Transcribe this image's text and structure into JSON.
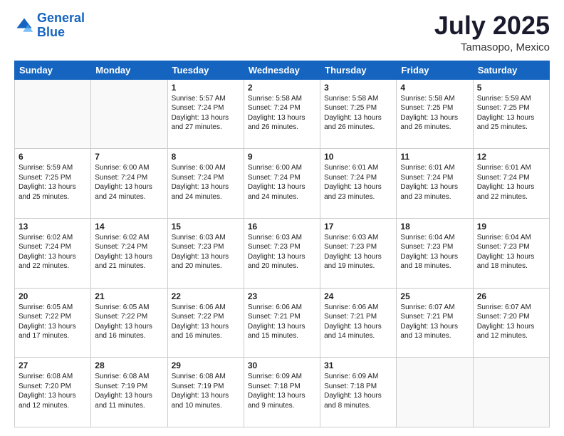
{
  "header": {
    "logo_line1": "General",
    "logo_line2": "Blue",
    "month": "July 2025",
    "location": "Tamasopo, Mexico"
  },
  "days_of_week": [
    "Sunday",
    "Monday",
    "Tuesday",
    "Wednesday",
    "Thursday",
    "Friday",
    "Saturday"
  ],
  "weeks": [
    [
      {
        "day": "",
        "info": ""
      },
      {
        "day": "",
        "info": ""
      },
      {
        "day": "1",
        "info": "Sunrise: 5:57 AM\nSunset: 7:24 PM\nDaylight: 13 hours and 27 minutes."
      },
      {
        "day": "2",
        "info": "Sunrise: 5:58 AM\nSunset: 7:24 PM\nDaylight: 13 hours and 26 minutes."
      },
      {
        "day": "3",
        "info": "Sunrise: 5:58 AM\nSunset: 7:25 PM\nDaylight: 13 hours and 26 minutes."
      },
      {
        "day": "4",
        "info": "Sunrise: 5:58 AM\nSunset: 7:25 PM\nDaylight: 13 hours and 26 minutes."
      },
      {
        "day": "5",
        "info": "Sunrise: 5:59 AM\nSunset: 7:25 PM\nDaylight: 13 hours and 25 minutes."
      }
    ],
    [
      {
        "day": "6",
        "info": "Sunrise: 5:59 AM\nSunset: 7:25 PM\nDaylight: 13 hours and 25 minutes."
      },
      {
        "day": "7",
        "info": "Sunrise: 6:00 AM\nSunset: 7:24 PM\nDaylight: 13 hours and 24 minutes."
      },
      {
        "day": "8",
        "info": "Sunrise: 6:00 AM\nSunset: 7:24 PM\nDaylight: 13 hours and 24 minutes."
      },
      {
        "day": "9",
        "info": "Sunrise: 6:00 AM\nSunset: 7:24 PM\nDaylight: 13 hours and 24 minutes."
      },
      {
        "day": "10",
        "info": "Sunrise: 6:01 AM\nSunset: 7:24 PM\nDaylight: 13 hours and 23 minutes."
      },
      {
        "day": "11",
        "info": "Sunrise: 6:01 AM\nSunset: 7:24 PM\nDaylight: 13 hours and 23 minutes."
      },
      {
        "day": "12",
        "info": "Sunrise: 6:01 AM\nSunset: 7:24 PM\nDaylight: 13 hours and 22 minutes."
      }
    ],
    [
      {
        "day": "13",
        "info": "Sunrise: 6:02 AM\nSunset: 7:24 PM\nDaylight: 13 hours and 22 minutes."
      },
      {
        "day": "14",
        "info": "Sunrise: 6:02 AM\nSunset: 7:24 PM\nDaylight: 13 hours and 21 minutes."
      },
      {
        "day": "15",
        "info": "Sunrise: 6:03 AM\nSunset: 7:23 PM\nDaylight: 13 hours and 20 minutes."
      },
      {
        "day": "16",
        "info": "Sunrise: 6:03 AM\nSunset: 7:23 PM\nDaylight: 13 hours and 20 minutes."
      },
      {
        "day": "17",
        "info": "Sunrise: 6:03 AM\nSunset: 7:23 PM\nDaylight: 13 hours and 19 minutes."
      },
      {
        "day": "18",
        "info": "Sunrise: 6:04 AM\nSunset: 7:23 PM\nDaylight: 13 hours and 18 minutes."
      },
      {
        "day": "19",
        "info": "Sunrise: 6:04 AM\nSunset: 7:23 PM\nDaylight: 13 hours and 18 minutes."
      }
    ],
    [
      {
        "day": "20",
        "info": "Sunrise: 6:05 AM\nSunset: 7:22 PM\nDaylight: 13 hours and 17 minutes."
      },
      {
        "day": "21",
        "info": "Sunrise: 6:05 AM\nSunset: 7:22 PM\nDaylight: 13 hours and 16 minutes."
      },
      {
        "day": "22",
        "info": "Sunrise: 6:06 AM\nSunset: 7:22 PM\nDaylight: 13 hours and 16 minutes."
      },
      {
        "day": "23",
        "info": "Sunrise: 6:06 AM\nSunset: 7:21 PM\nDaylight: 13 hours and 15 minutes."
      },
      {
        "day": "24",
        "info": "Sunrise: 6:06 AM\nSunset: 7:21 PM\nDaylight: 13 hours and 14 minutes."
      },
      {
        "day": "25",
        "info": "Sunrise: 6:07 AM\nSunset: 7:21 PM\nDaylight: 13 hours and 13 minutes."
      },
      {
        "day": "26",
        "info": "Sunrise: 6:07 AM\nSunset: 7:20 PM\nDaylight: 13 hours and 12 minutes."
      }
    ],
    [
      {
        "day": "27",
        "info": "Sunrise: 6:08 AM\nSunset: 7:20 PM\nDaylight: 13 hours and 12 minutes."
      },
      {
        "day": "28",
        "info": "Sunrise: 6:08 AM\nSunset: 7:19 PM\nDaylight: 13 hours and 11 minutes."
      },
      {
        "day": "29",
        "info": "Sunrise: 6:08 AM\nSunset: 7:19 PM\nDaylight: 13 hours and 10 minutes."
      },
      {
        "day": "30",
        "info": "Sunrise: 6:09 AM\nSunset: 7:18 PM\nDaylight: 13 hours and 9 minutes."
      },
      {
        "day": "31",
        "info": "Sunrise: 6:09 AM\nSunset: 7:18 PM\nDaylight: 13 hours and 8 minutes."
      },
      {
        "day": "",
        "info": ""
      },
      {
        "day": "",
        "info": ""
      }
    ]
  ]
}
